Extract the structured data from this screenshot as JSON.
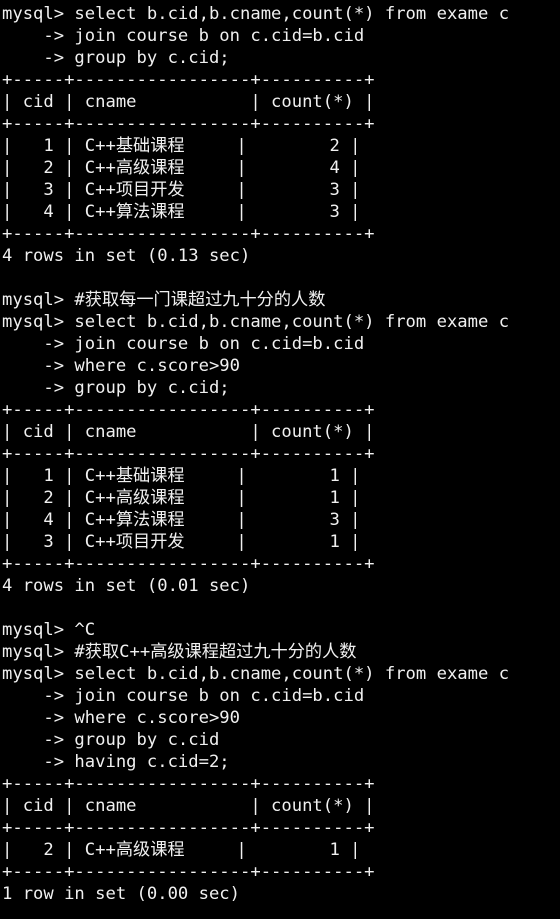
{
  "terminal": {
    "lines": [
      "mysql> select b.cid,b.cname,count(*) from exame c",
      "    -> join course b on c.cid=b.cid",
      "    -> group by c.cid;",
      "+-----+-----------------+----------+",
      "| cid | cname           | count(*) |",
      "+-----+-----------------+----------+",
      "|   1 | C++基础课程     |        2 |",
      "|   2 | C++高级课程     |        4 |",
      "|   3 | C++项目开发     |        3 |",
      "|   4 | C++算法课程     |        3 |",
      "+-----+-----------------+----------+",
      "4 rows in set (0.13 sec)",
      "",
      "mysql> #获取每一门课超过九十分的人数",
      "mysql> select b.cid,b.cname,count(*) from exame c",
      "    -> join course b on c.cid=b.cid",
      "    -> where c.score>90",
      "    -> group by c.cid;",
      "+-----+-----------------+----------+",
      "| cid | cname           | count(*) |",
      "+-----+-----------------+----------+",
      "|   1 | C++基础课程     |        1 |",
      "|   2 | C++高级课程     |        1 |",
      "|   4 | C++算法课程     |        3 |",
      "|   3 | C++项目开发     |        1 |",
      "+-----+-----------------+----------+",
      "4 rows in set (0.01 sec)",
      "",
      "mysql> ^C",
      "mysql> #获取C++高级课程超过九十分的人数",
      "mysql> select b.cid,b.cname,count(*) from exame c",
      "    -> join course b on c.cid=b.cid",
      "    -> where c.score>90",
      "    -> group by c.cid",
      "    -> having c.cid=2;",
      "+-----+-----------------+----------+",
      "| cid | cname           | count(*) |",
      "+-----+-----------------+----------+",
      "|   2 | C++高级课程     |        1 |",
      "+-----+-----------------+----------+",
      "1 row in set (0.00 sec)"
    ]
  }
}
